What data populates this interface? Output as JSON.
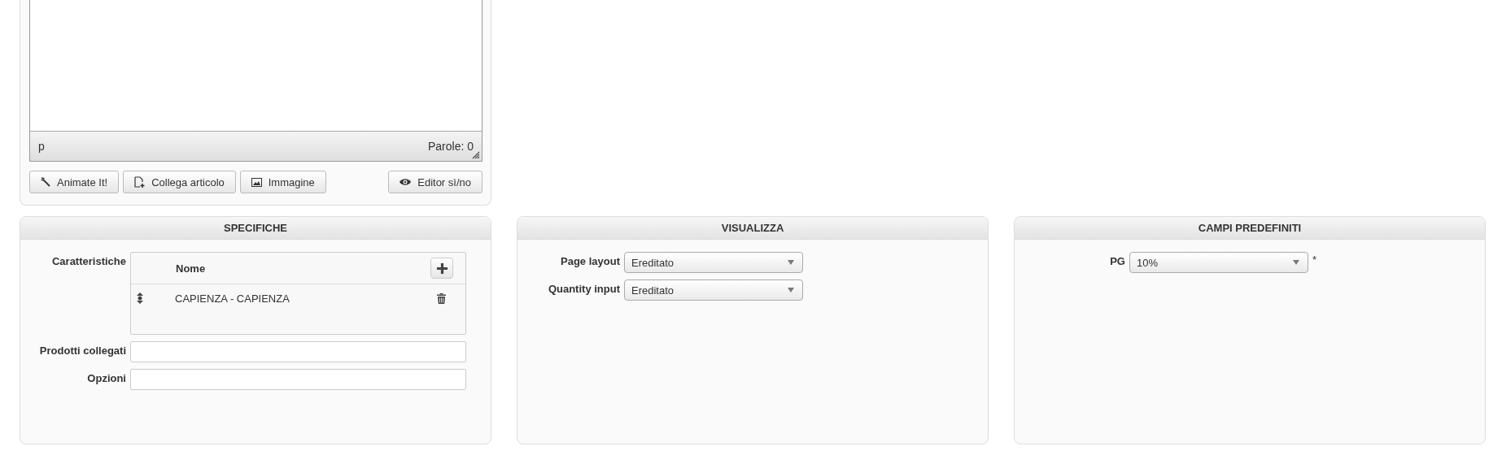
{
  "editor": {
    "status_path": "p",
    "word_count": "Parole: 0",
    "buttons": [
      {
        "label": "Animate It!"
      },
      {
        "label": "Collega articolo"
      },
      {
        "label": "Immagine"
      },
      {
        "label": "Editor sì/no"
      }
    ]
  },
  "panels": [
    {
      "title": "SPECIFICHE",
      "fields": [
        {
          "kind": "table",
          "label": "Caratteristiche",
          "columns": [
            "Nome"
          ],
          "rows": [
            {
              "name": "CAPIENZA - CAPIENZA"
            }
          ]
        },
        {
          "kind": "text",
          "label": "Prodotti collegati"
        },
        {
          "kind": "text",
          "label": "Opzioni"
        }
      ]
    },
    {
      "title": "VISUALIZZA",
      "fields": [
        {
          "kind": "select",
          "label": "Page layout",
          "value": "Ereditato"
        },
        {
          "kind": "select",
          "label": "Quantity input",
          "value": "Ereditato"
        }
      ]
    },
    {
      "title": "CAMPI PREDEFINITI",
      "fields": [
        {
          "kind": "select",
          "label": "PG",
          "value": "10%",
          "suffix": "*"
        }
      ]
    }
  ]
}
